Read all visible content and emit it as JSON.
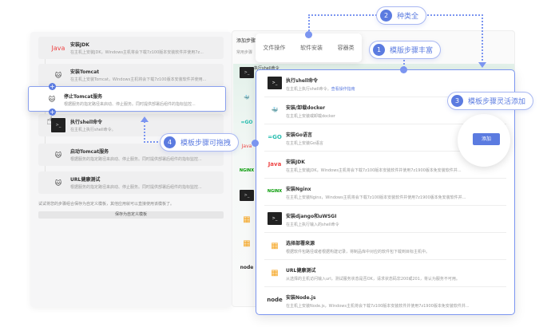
{
  "left_panel": {
    "cards": [
      {
        "title": "安装JDK",
        "desc": "在主机上安装JDK，Windows主机将会下载7z100版本安装软件并使用7z...",
        "icon": "java-icon"
      },
      {
        "title": "安装Tomcat",
        "desc": "在主机上安装Tomcat，Windows主机将会下载7z100版本安装软件并使用...",
        "icon": "tomcat-icon"
      },
      {
        "title": "执行shell命令",
        "desc": "在主机上执行shell命令。",
        "icon": "terminal-icon"
      },
      {
        "title": "启动Tomcat服务",
        "desc": "根据服务的指定路径来启动、停止服务。同时提供部署后组件的指标监控...",
        "icon": "tomcat-icon"
      },
      {
        "title": "URL健康测试",
        "desc": "根据服务的指定路径来启动、停止服务。同时提供部署后组件的指标监控...",
        "icon": "tomcat-icon"
      }
    ],
    "dragged_card": {
      "title": "停止Tomcat服务",
      "desc": "根据服务的指定路径来启动、停止服务。同时提供部署后组件的指标监控..."
    },
    "hint": "试试将您的步骤组合保存为自定义模板，其他应用就可以直接使用该模板了。",
    "save_button": "保存为自定义模板"
  },
  "middle": {
    "title": "添加步骤",
    "subtitle": "常用步骤",
    "first_row": "执行shell命令"
  },
  "tabs": [
    "文件操作",
    "软件安装",
    "容器类"
  ],
  "badges": [
    {
      "num": "1",
      "text": "模版步骤丰富"
    },
    {
      "num": "2",
      "text": "种类全"
    },
    {
      "num": "3",
      "text": "模板步骤灵活添加"
    },
    {
      "num": "4",
      "text": "模板步骤可拖拽"
    }
  ],
  "step_list": [
    {
      "title": "执行shell命令",
      "desc": "在主机上执行shell命令。",
      "link": "查看操作指南",
      "icon": "terminal-icon"
    },
    {
      "title": "安装/卸载docker",
      "desc": "在主机上安装或卸载docker",
      "icon": "docker-icon"
    },
    {
      "title": "安装Go语言",
      "desc": "在主机上安装Go语言",
      "icon": "go-icon"
    },
    {
      "title": "安装JDK",
      "desc": "在主机上安装JDK，Windows主机将会下载7z100版本安装软件并使用7z1900版本免安装软件并...",
      "icon": "java-icon"
    },
    {
      "title": "安装Nginx",
      "desc": "在主机上安装Nginx，Windows主机将会下载7z100版本安装软件并使用7z1900版本免安装软件并...",
      "icon": "nginx-icon"
    },
    {
      "title": "安装django和uWSGI",
      "desc": "在主机上执行输入的shell命令",
      "icon": "terminal-icon"
    },
    {
      "title": "选择部署来源",
      "desc": "根据软件包路径或者根据构建记录，将制品库中对应的软件包下载到目标主机中。",
      "icon": "package-icon"
    },
    {
      "title": "URL健康测试",
      "desc": "从选择的主机访问输入url，测试服务状态是否OK，请求状态码非200或201，将认为服务不可用。",
      "icon": "package-icon"
    },
    {
      "title": "安装Node.js",
      "desc": "在主机上安装Node.js，Windows主机将会下载7z100版本安装软件并使用7z1900版本免安装软件并...",
      "icon": "nodejs-icon"
    }
  ],
  "add_button": "添加",
  "icon_text": {
    "java": "Java",
    "go": "=GO",
    "nginx": "NGINX",
    "node": "node",
    "term": ">_",
    "pkg": "▦",
    "docker": "🐳",
    "tomcat": "🐱"
  },
  "colors": {
    "accent": "#5b7be0",
    "border": "#7b95f0"
  }
}
